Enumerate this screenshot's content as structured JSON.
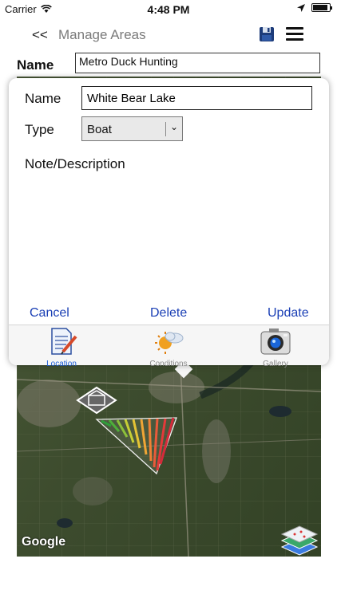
{
  "status": {
    "carrier": "Carrier",
    "time": "4:48 PM",
    "battery_level": 0.9
  },
  "nav": {
    "back_label": "<<",
    "title": "Manage Areas",
    "icons": [
      "save-icon",
      "menu-icon"
    ]
  },
  "form": {
    "name_label": "Name",
    "name_value": "Metro Duck Hunting"
  },
  "modal": {
    "name_label": "Name",
    "name_value": "White Bear Lake",
    "type_label": "Type",
    "type_value": "Boat",
    "note_label": "Note/Description",
    "cancel_label": "Cancel",
    "delete_label": "Delete",
    "update_label": "Update"
  },
  "tabs": [
    {
      "label": "Location",
      "icon": "location-notepad-icon",
      "active": true
    },
    {
      "label": "Conditions",
      "icon": "weather-conditions-icon",
      "active": false
    },
    {
      "label": "Gallery",
      "icon": "camera-icon",
      "active": false
    }
  ],
  "map": {
    "attribution": "Google",
    "icons": [
      "boat-marker-icon",
      "map-layers-icon"
    ]
  },
  "colors": {
    "accent": "#1a3fb5",
    "tab_active": "#1a5bd6"
  }
}
